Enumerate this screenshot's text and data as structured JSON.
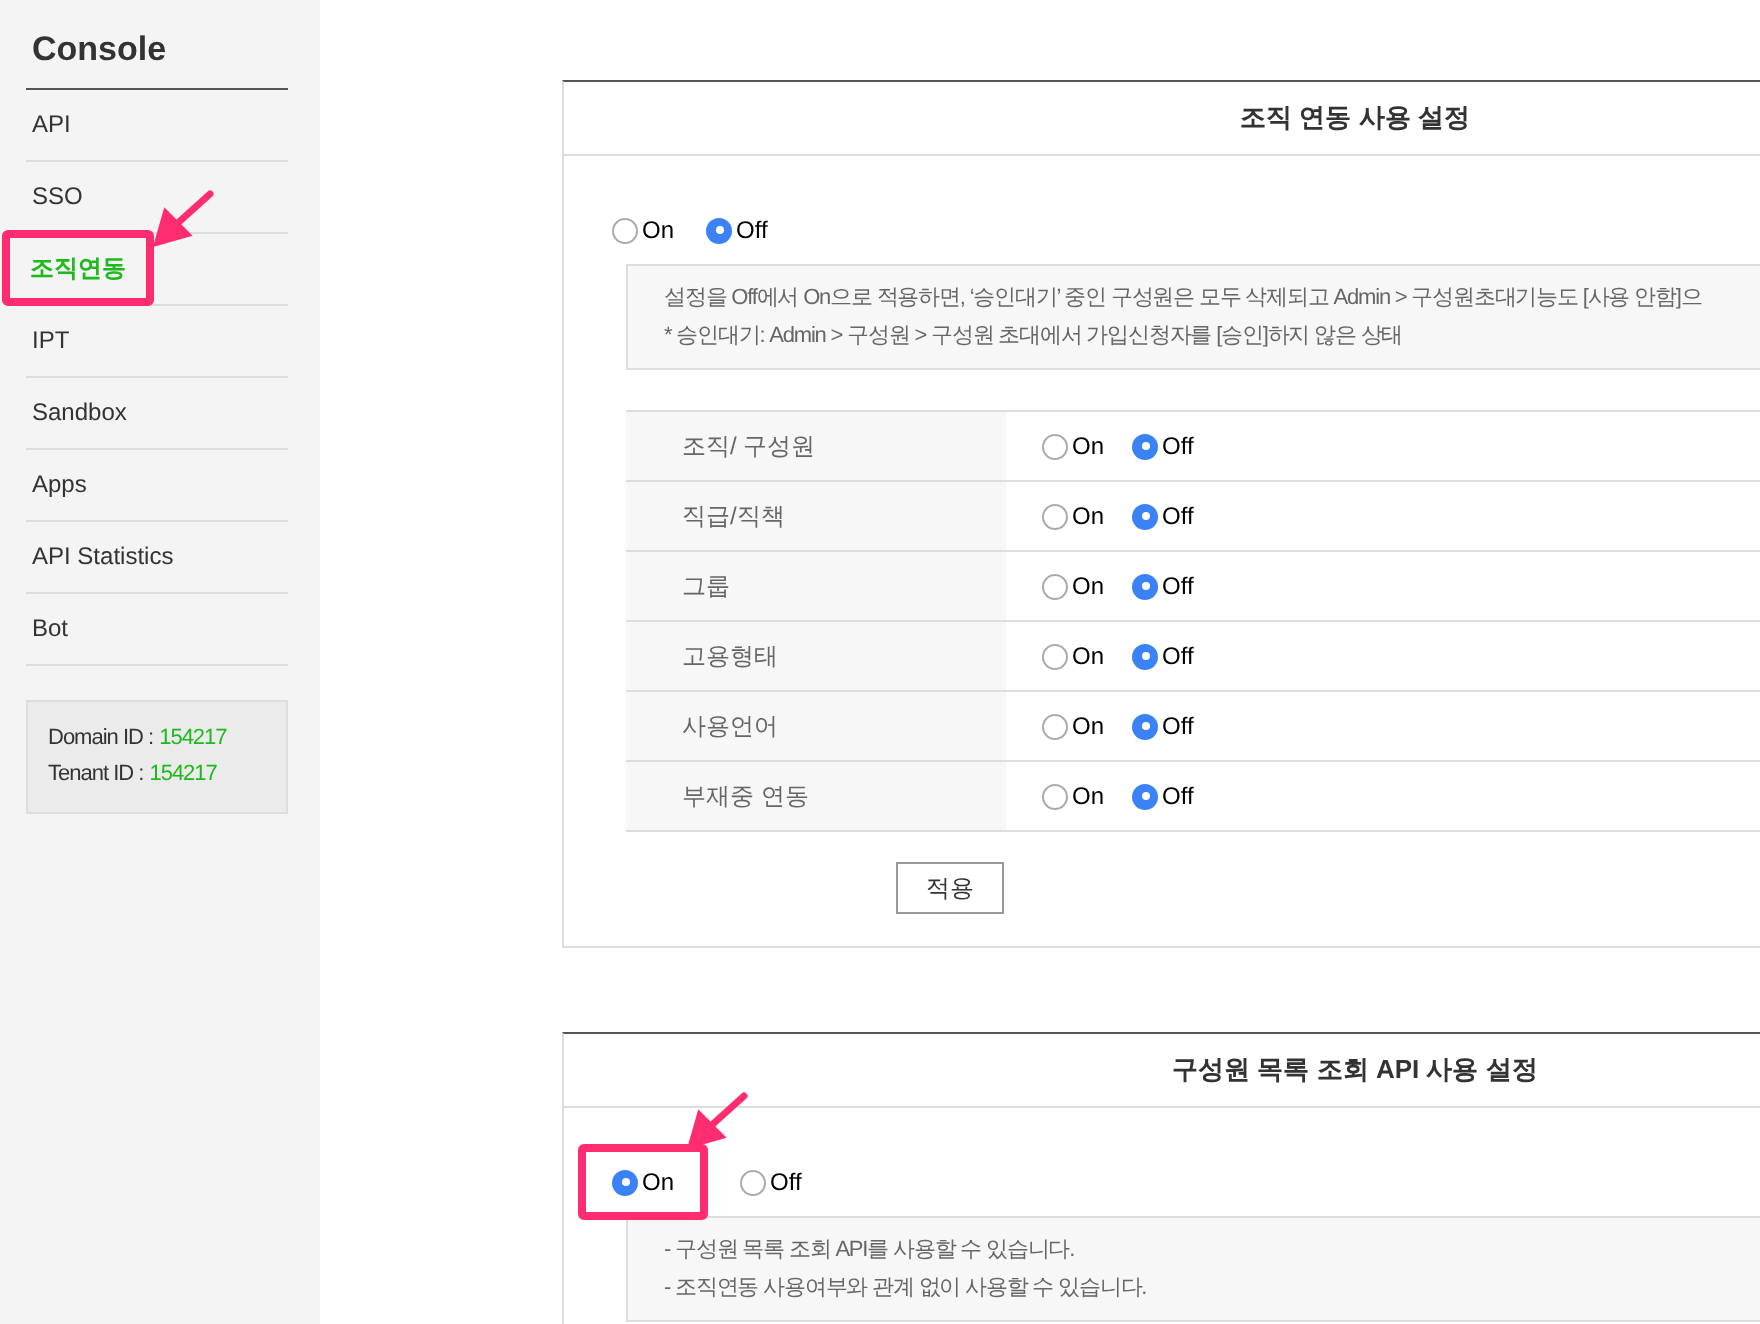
{
  "sidebar": {
    "title": "Console",
    "items": [
      {
        "label": "API",
        "selected": false,
        "annotated": false
      },
      {
        "label": "SSO",
        "selected": false,
        "annotated": false
      },
      {
        "label": "조직연동",
        "selected": true,
        "annotated": true
      },
      {
        "label": "IPT",
        "selected": false,
        "annotated": false
      },
      {
        "label": "Sandbox",
        "selected": false,
        "annotated": false
      },
      {
        "label": "Apps",
        "selected": false,
        "annotated": false
      },
      {
        "label": "API Statistics",
        "selected": false,
        "annotated": false
      },
      {
        "label": "Bot",
        "selected": false,
        "annotated": false
      }
    ],
    "info": [
      {
        "label": "Domain ID :",
        "value": "154217"
      },
      {
        "label": "Tenant ID :",
        "value": "154217"
      }
    ]
  },
  "sections": [
    {
      "title": "조직 연동 사용 설정",
      "options": [
        {
          "label": "On",
          "selected": false,
          "annotated": false
        },
        {
          "label": "Off",
          "selected": true,
          "annotated": false
        }
      ],
      "notes": [
        "설정을 Off에서 On으로 적용하면, ‘승인대기’ 중인 구성원은 모두 삭제되고 Admin > 구성원초대기능도 [사용 안함]으",
        "* 승인대기: Admin > 구성원 > 구성원 초대에서 가입신청자를 [승인]하지 않은 상태"
      ],
      "rows": [
        {
          "label": "조직/ 구성원",
          "options": [
            {
              "label": "On",
              "selected": false
            },
            {
              "label": "Off",
              "selected": true
            }
          ]
        },
        {
          "label": "직급/직책",
          "options": [
            {
              "label": "On",
              "selected": false
            },
            {
              "label": "Off",
              "selected": true
            }
          ]
        },
        {
          "label": "그룹",
          "options": [
            {
              "label": "On",
              "selected": false
            },
            {
              "label": "Off",
              "selected": true
            }
          ]
        },
        {
          "label": "고용형태",
          "options": [
            {
              "label": "On",
              "selected": false
            },
            {
              "label": "Off",
              "selected": true
            }
          ]
        },
        {
          "label": "사용언어",
          "options": [
            {
              "label": "On",
              "selected": false
            },
            {
              "label": "Off",
              "selected": true
            }
          ]
        },
        {
          "label": "부재중 연동",
          "options": [
            {
              "label": "On",
              "selected": false
            },
            {
              "label": "Off",
              "selected": true
            }
          ]
        }
      ],
      "button": "적용"
    },
    {
      "title": "구성원 목록 조회 API 사용 설정",
      "options": [
        {
          "label": "On",
          "selected": true,
          "annotated": true
        },
        {
          "label": "Off",
          "selected": false,
          "annotated": false
        }
      ],
      "notes": [
        "- 구성원 목록 조회 API를 사용할 수 있습니다.",
        "- 조직연동 사용여부와 관계 없이 사용할 수 있습니다."
      ]
    }
  ]
}
